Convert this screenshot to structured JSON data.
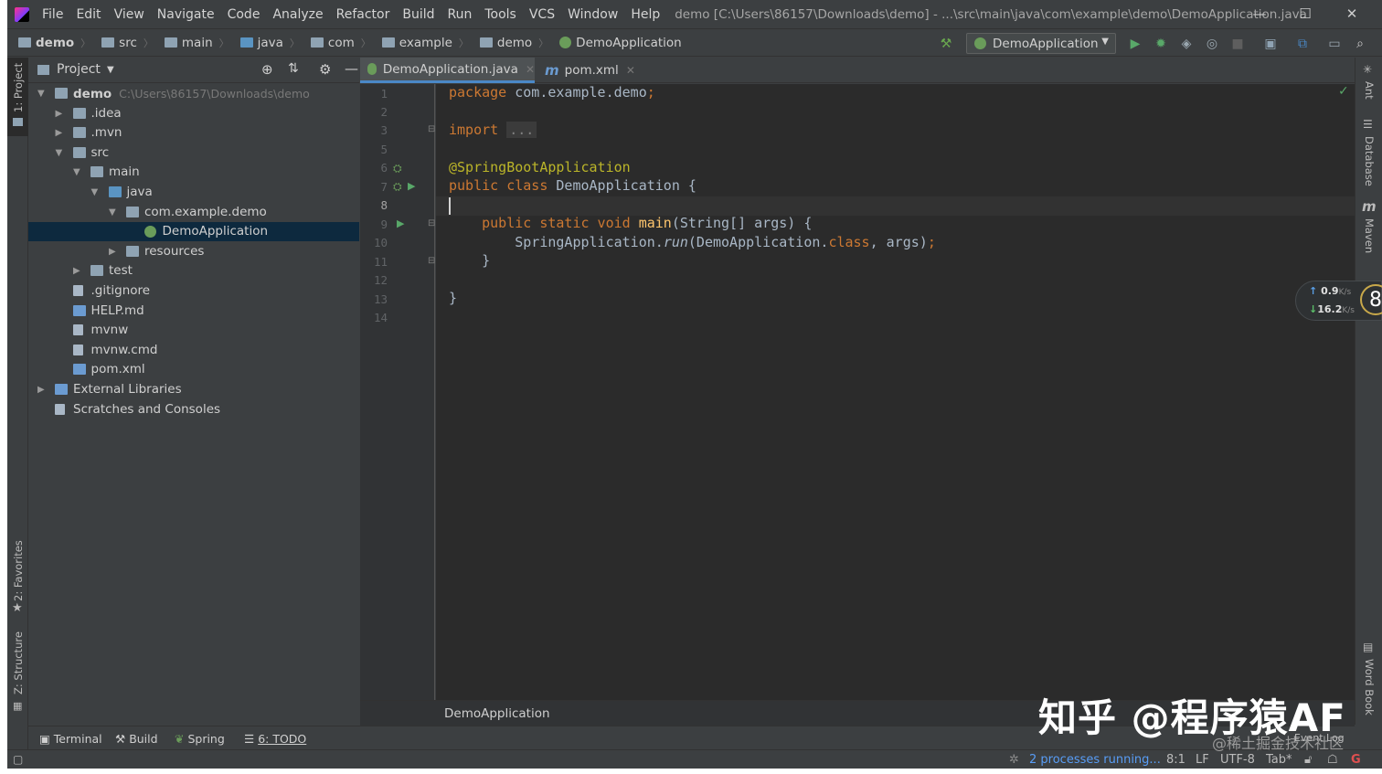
{
  "menu": [
    "File",
    "Edit",
    "View",
    "Navigate",
    "Code",
    "Analyze",
    "Refactor",
    "Build",
    "Run",
    "Tools",
    "VCS",
    "Window",
    "Help"
  ],
  "window_title": "demo [C:\\Users\\86157\\Downloads\\demo] - ...\\src\\main\\java\\com\\example\\demo\\DemoApplication.java",
  "breadcrumbs": [
    "demo",
    "src",
    "main",
    "java",
    "com",
    "example",
    "demo",
    "DemoApplication"
  ],
  "run_config": "DemoApplication",
  "left_strip": {
    "project": "1: Project",
    "favorites": "2: Favorites",
    "structure": "Z: Structure"
  },
  "project_panel": {
    "title": "Project",
    "tree": [
      {
        "label": "demo",
        "extra": "C:\\Users\\86157\\Downloads\\demo",
        "depth": 0,
        "expanded": true,
        "icon": "folder"
      },
      {
        "label": ".idea",
        "depth": 1,
        "expanded": false,
        "icon": "folder"
      },
      {
        "label": ".mvn",
        "depth": 1,
        "expanded": false,
        "icon": "folder"
      },
      {
        "label": "src",
        "depth": 1,
        "expanded": true,
        "icon": "folder"
      },
      {
        "label": "main",
        "depth": 2,
        "expanded": true,
        "icon": "folder"
      },
      {
        "label": "java",
        "depth": 3,
        "expanded": true,
        "icon": "source-folder"
      },
      {
        "label": "com.example.demo",
        "depth": 4,
        "expanded": true,
        "icon": "package"
      },
      {
        "label": "DemoApplication",
        "depth": 5,
        "icon": "spring-class",
        "selected": true
      },
      {
        "label": "resources",
        "depth": 4,
        "expanded": false,
        "icon": "resources-folder"
      },
      {
        "label": "test",
        "depth": 2,
        "expanded": false,
        "icon": "folder"
      },
      {
        "label": ".gitignore",
        "depth": 1,
        "icon": "file"
      },
      {
        "label": "HELP.md",
        "depth": 1,
        "icon": "markdown-file"
      },
      {
        "label": "mvnw",
        "depth": 1,
        "icon": "file"
      },
      {
        "label": "mvnw.cmd",
        "depth": 1,
        "icon": "file"
      },
      {
        "label": "pom.xml",
        "depth": 1,
        "icon": "maven-file"
      },
      {
        "label": "External Libraries",
        "depth": 0,
        "expanded": false,
        "icon": "library"
      },
      {
        "label": "Scratches and Consoles",
        "depth": 0,
        "icon": "scratch"
      }
    ]
  },
  "tabs": [
    {
      "label": "DemoApplication.java",
      "active": true
    },
    {
      "label": "pom.xml",
      "active": false
    }
  ],
  "code_lines": [
    {
      "n": "1",
      "text": "package com.example.demo;"
    },
    {
      "n": "2",
      "text": ""
    },
    {
      "n": "3",
      "text": "import ..."
    },
    {
      "n": "5",
      "text": ""
    },
    {
      "n": "6",
      "text": "@SpringBootApplication"
    },
    {
      "n": "7",
      "text": "public class DemoApplication {"
    },
    {
      "n": "8",
      "text": ""
    },
    {
      "n": "9",
      "text": "    public static void main(String[] args) {"
    },
    {
      "n": "10",
      "text": "        SpringApplication.run(DemoApplication.class, args);"
    },
    {
      "n": "11",
      "text": "    }"
    },
    {
      "n": "12",
      "text": ""
    },
    {
      "n": "13",
      "text": "}"
    },
    {
      "n": "14",
      "text": ""
    }
  ],
  "editor_breadcrumb": "DemoApplication",
  "right_strip": [
    "Ant",
    "Database",
    "Maven",
    "Word Book"
  ],
  "bottom_tools": [
    "Terminal",
    "Build",
    "Spring",
    "6: TODO"
  ],
  "status": {
    "processes": "2 processes running...",
    "position": "8:1",
    "line_sep": "LF",
    "encoding": "UTF-8",
    "indent": "Tab*",
    "event_log": "Event Log"
  },
  "net_widget": {
    "up": "0.9",
    "down": "16.2",
    "unit": "K/s",
    "badge": "8"
  },
  "watermark": {
    "main": "知乎 @程序猿AF",
    "sub": "@稀土掘金技术社区"
  },
  "colors": {
    "bg": "#3c3f41",
    "editor": "#2b2b2b",
    "keyword": "#cc7832",
    "annotation": "#bbb529",
    "method": "#ffc66d",
    "selection": "#0d293e"
  }
}
